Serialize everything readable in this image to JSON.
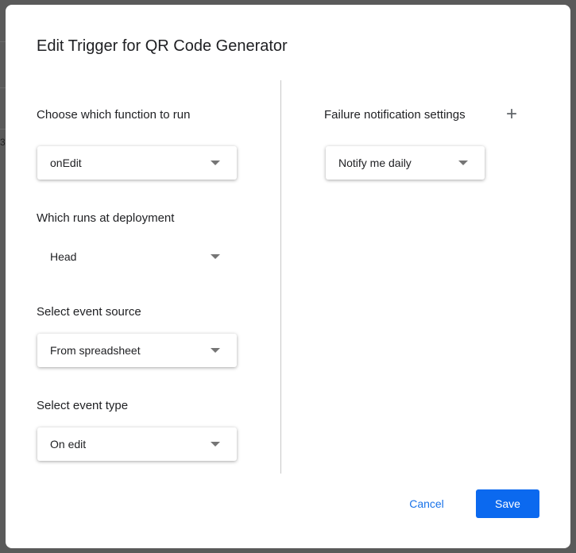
{
  "background": {
    "row_number": "3"
  },
  "dialog": {
    "title": "Edit Trigger for QR Code Generator",
    "function": {
      "label": "Choose which function to run",
      "value": "onEdit"
    },
    "deployment": {
      "label": "Which runs at deployment",
      "value": "Head"
    },
    "event_source": {
      "label": "Select event source",
      "value": "From spreadsheet"
    },
    "event_type": {
      "label": "Select event type",
      "value": "On edit"
    },
    "failure": {
      "label": "Failure notification settings",
      "value": "Notify me daily",
      "add_icon": "+"
    },
    "cancel_label": "Cancel",
    "save_label": "Save"
  },
  "colors": {
    "primary": "#0b69ef",
    "link": "#1a73e8"
  }
}
